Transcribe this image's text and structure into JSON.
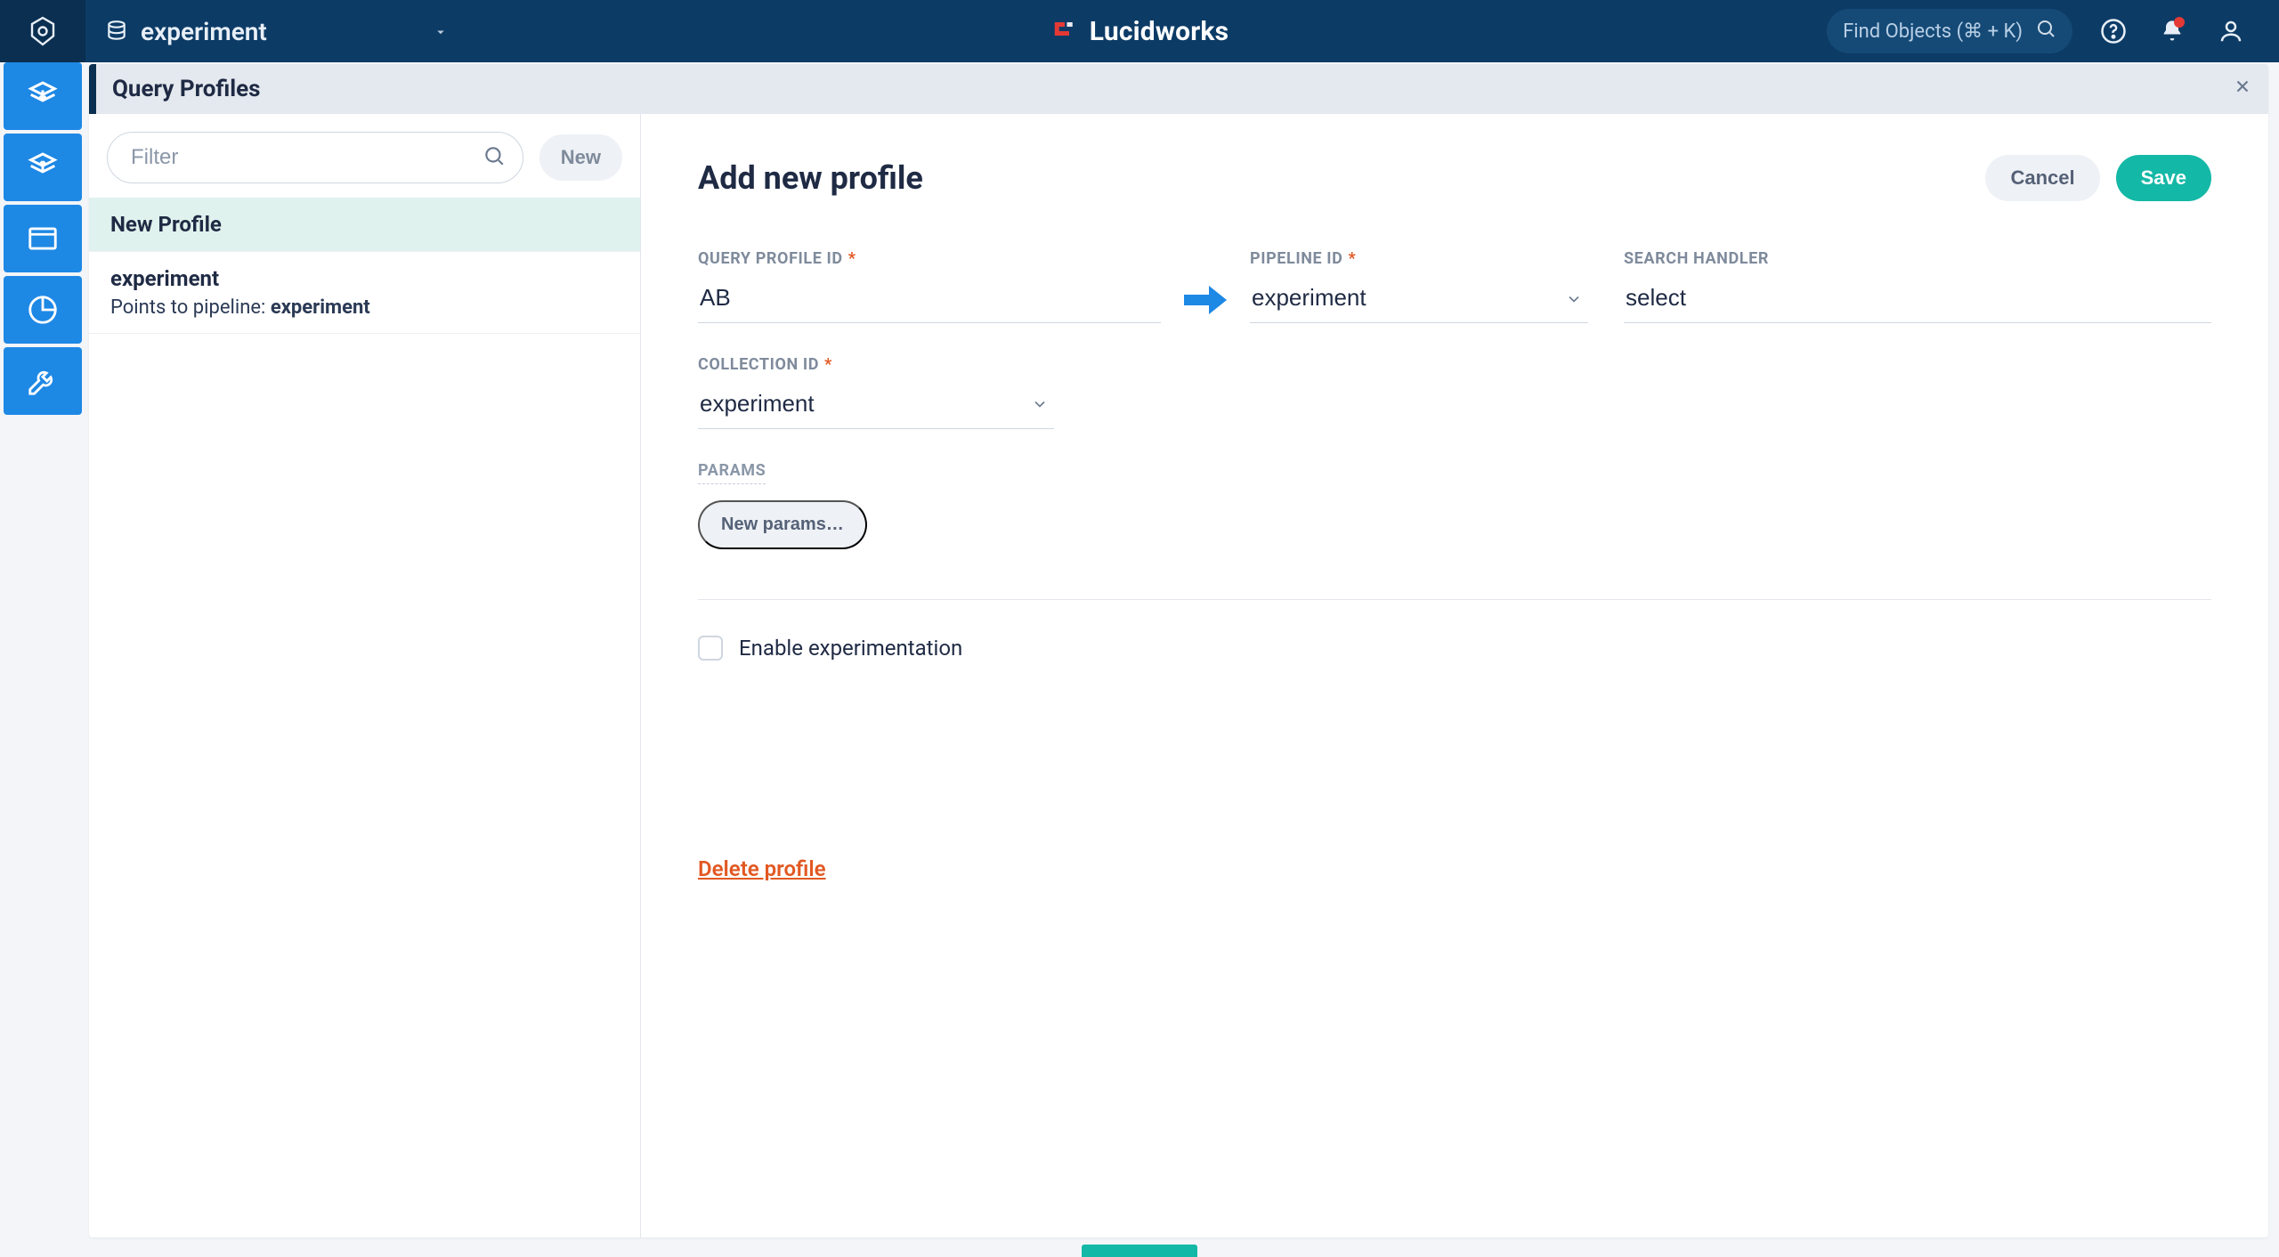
{
  "topbar": {
    "app_name": "experiment",
    "brand": "Lucidworks",
    "find_placeholder": "Find Objects (⌘ + K)"
  },
  "panel": {
    "title": "Query Profiles"
  },
  "sidebar": {
    "filter_placeholder": "Filter",
    "new_label": "New",
    "items": [
      {
        "title": "New Profile",
        "active": true
      },
      {
        "title": "experiment",
        "sub_prefix": "Points to pipeline: ",
        "sub_value": "experiment"
      }
    ]
  },
  "main": {
    "title": "Add new profile",
    "cancel_label": "Cancel",
    "save_label": "Save",
    "labels": {
      "query_profile_id": "QUERY PROFILE ID",
      "pipeline_id": "PIPELINE ID",
      "search_handler": "SEARCH HANDLER",
      "collection_id": "COLLECTION ID",
      "params": "PARAMS"
    },
    "values": {
      "query_profile_id": "AB",
      "pipeline_id": "experiment",
      "search_handler": "select",
      "collection_id": "experiment"
    },
    "new_params_label": "New params…",
    "enable_experimentation_label": "Enable experimentation",
    "delete_label": "Delete profile"
  },
  "colors": {
    "accent_teal": "#14b8a6",
    "brand_blue": "#0c3b66",
    "rail_blue": "#1e88e5",
    "danger": "#e25822"
  }
}
